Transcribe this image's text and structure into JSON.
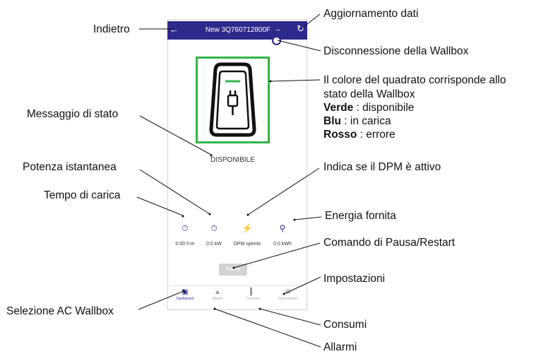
{
  "app": {
    "title": "New 3Q760712800F",
    "status": "DISPONIBILE",
    "status_color": "#33b34a",
    "accent_color": "#2e2a8c",
    "icons": {
      "back": "back-arrow-icon",
      "bluetooth": "bluetooth-icon",
      "refresh": "refresh-icon",
      "wallbox": "wallbox-plug-icon"
    },
    "metrics": [
      {
        "icon": "stopwatch-icon",
        "value": "0:00 h:m"
      },
      {
        "icon": "stopwatch-icon",
        "value": "0.0 kW"
      },
      {
        "icon": "bolt-icon",
        "value": "DPM spento"
      },
      {
        "icon": "bulb-icon",
        "value": "0.0 kWh"
      }
    ],
    "pause_label": "Pausa",
    "nav": [
      {
        "label": "Dashboard",
        "icon": "dashboard-icon",
        "active": true
      },
      {
        "label": "Allarmi",
        "icon": "warning-icon",
        "active": false
      },
      {
        "label": "Consumi",
        "icon": "bar-chart-icon",
        "active": false
      },
      {
        "label": "Impostazioni",
        "icon": "settings-icon",
        "active": false
      }
    ]
  },
  "annotations": {
    "indietro": "Indietro",
    "aggiornamento": "Aggiornamento dati",
    "disconnessione": "Disconnessione della Wallbox",
    "colore_line1": "Il colore del quadrato corrisponde allo",
    "colore_line2": "stato della Wallbox",
    "verde": "Verde",
    "verde_desc": " : disponibile",
    "blu": "Blu",
    "blu_desc": " : in carica",
    "rosso": "Rosso",
    "rosso_desc": " : errore",
    "messaggio": "Messaggio di stato",
    "potenza": "Potenza istantanea",
    "dpm": "Indica se il DPM è attivo",
    "tempo": "Tempo di carica",
    "energia": "Energia fornita",
    "pausa": "Comando di Pausa/Restart",
    "impostazioni": "Impostazioni",
    "selezione": "Selezione AC Wallbox",
    "consumi": "Consumi",
    "allarmi": "Allarmi"
  }
}
